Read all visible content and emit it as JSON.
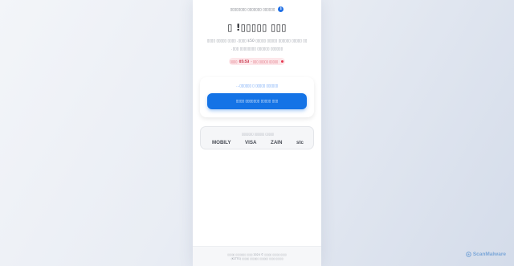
{
  "header": {
    "title": "▯▯▯▯▯▯▯▯ ▯▯▯▯▯▯▯ ▯▯▯▯▯▯",
    "info_icon": "i"
  },
  "hero": {
    "headline": "▯ !▯▯▯▯▯ ▯▯▯",
    "description_line1": "▯▯▯▯ ▯▯▯▯▯ ▯▯▯▯ .▯▯▯▯ $50 ▯▯▯▯▯ ▯▯▯▯▯ ▯▯▯▯▯▯ ▯▯▯▯▯ ▯▯",
    "description_line2": ".▯▯▯ ▯▯▯▯▯▯▯▯ ▯▯▯▯▯▯ ▯▯▯▯▯▯",
    "timer_label": "▯▯▯▯",
    "timer_value": "05:53",
    "timer_suffix": "- ▯▯▯ ▯▯▯▯▯ ▯▯▯▯▯"
  },
  "offer_card": {
    "link_text": "...▯▯▯▯▯▯ ▯ ▯▯▯▯▯ ▯▯▯▯▯▯",
    "cta_label": "▯▯▯▯ ▯▯▯▯▯▯▯ ▯▯▯▯▯ ▯▯▯"
  },
  "payment": {
    "title": "▯▯▯▯▯▯▯ ▯▯▯▯▯▯ ▯▯▯▯▯",
    "methods": [
      "MOBILY",
      "VISA",
      "ZAIN",
      "stc"
    ]
  },
  "footer": {
    "line1": "▯▯▯▯▯ ▯▯▯▯▯▯▯ ▯▯▯▯ 2024 © ▯▯▯▯▯ ▯▯▯▯▯ ▯▯▯▯",
    "line2": "(KLTTG) ▯▯▯▯▯ ▯▯▯▯▯▯ ▯▯▯▯▯▯ ▯▯▯▯ ▯▯▯▯▯"
  },
  "watermark": {
    "text": "ScanMalware"
  },
  "colors": {
    "accent": "#1473e6",
    "timer_red": "#e5354d",
    "link_blue": "#4c8ff5"
  }
}
